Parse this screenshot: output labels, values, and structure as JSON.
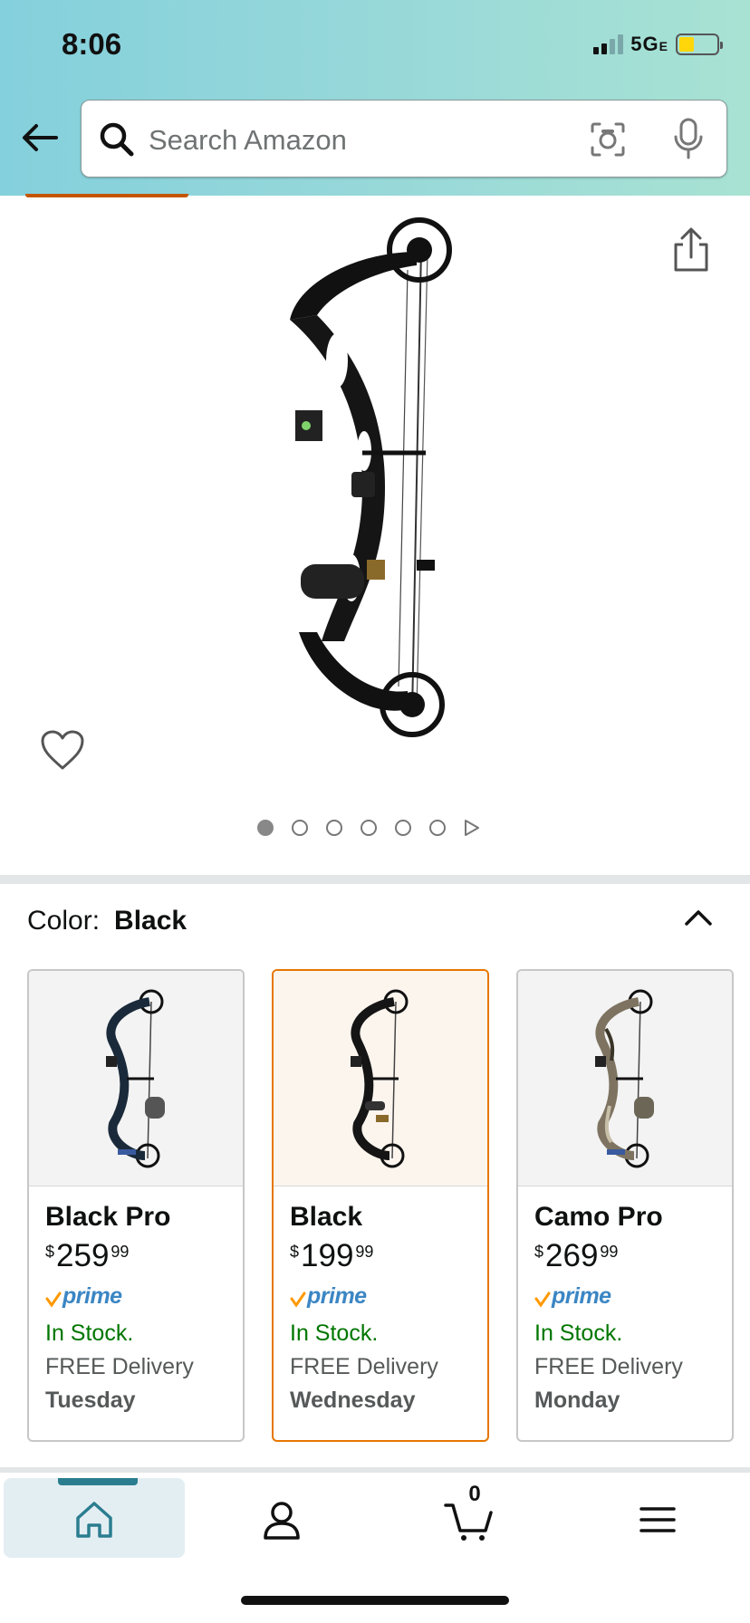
{
  "status_bar": {
    "time": "8:06",
    "network": "5G",
    "network_suffix": "E",
    "battery_color": "#ffd60a"
  },
  "search": {
    "placeholder": "Search Amazon"
  },
  "product": {
    "image_alt": "compound-bow-black",
    "carousel": {
      "total_dots": 6,
      "active_index": 0
    }
  },
  "color_selector": {
    "label": "Color:",
    "selected": "Black"
  },
  "variants": [
    {
      "name": "Black Pro",
      "currency": "$",
      "price_whole": "259",
      "price_fraction": "99",
      "prime": "prime",
      "stock": "In Stock.",
      "delivery": "FREE Delivery",
      "day": "Tuesday",
      "selected": false,
      "finish": "black-blue"
    },
    {
      "name": "Black",
      "currency": "$",
      "price_whole": "199",
      "price_fraction": "99",
      "prime": "prime",
      "stock": "In Stock.",
      "delivery": "FREE Delivery",
      "day": "Wednesday",
      "selected": true,
      "finish": "black-gold"
    },
    {
      "name": "Camo Pro",
      "currency": "$",
      "price_whole": "269",
      "price_fraction": "99",
      "prime": "prime",
      "stock": "In Stock.",
      "delivery": "FREE Delivery",
      "day": "Monday",
      "selected": false,
      "finish": "camo"
    }
  ],
  "bottom_nav": {
    "items": [
      "home-icon",
      "account-icon",
      "cart-icon",
      "menu-icon"
    ],
    "cart_count": "0",
    "active": "home"
  },
  "colors": {
    "header_gradient_start": "#84d0dc",
    "header_gradient_end": "#a8e2d3",
    "selected_border": "#e77600",
    "in_stock": "#007600",
    "prime_blue": "#3b86c4"
  }
}
